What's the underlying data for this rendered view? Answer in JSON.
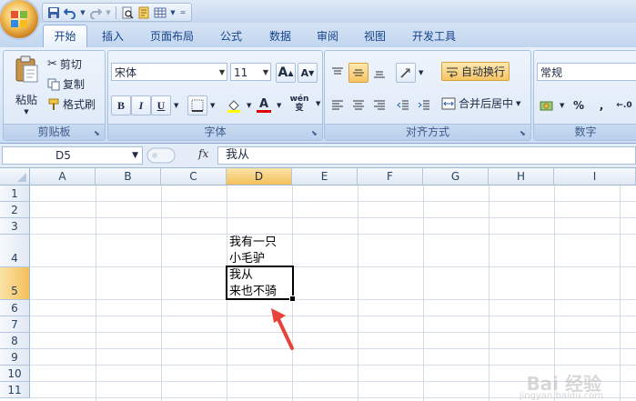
{
  "quick_access": {
    "save_icon": "save-icon",
    "undo_icon": "undo-icon",
    "redo_icon": "redo-icon"
  },
  "tabs": [
    "开始",
    "插入",
    "页面布局",
    "公式",
    "数据",
    "审阅",
    "视图",
    "开发工具"
  ],
  "clipboard": {
    "paste_label": "粘贴",
    "cut_label": "剪切",
    "copy_label": "复制",
    "format_painter_label": "格式刷",
    "group_label": "剪贴板"
  },
  "font": {
    "name": "宋体",
    "size": "11",
    "bold": "B",
    "italic": "I",
    "underline": "U",
    "font_color_glyph": "A",
    "phonetic_glyph": "wén 变",
    "grow_glyph": "A",
    "shrink_glyph": "A",
    "group_label": "字体"
  },
  "alignment": {
    "wrap_text_label": "自动换行",
    "merge_center_label": "合并后居中",
    "group_label": "对齐方式"
  },
  "number": {
    "format": "常规",
    "percent_glyph": "%",
    "comma_glyph": ",",
    "group_label": "数字"
  },
  "formula_bar": {
    "name_box": "D5",
    "fx": "fx",
    "content": "我从"
  },
  "grid": {
    "columns": [
      "A",
      "B",
      "C",
      "D",
      "E",
      "F",
      "G",
      "H",
      "I"
    ],
    "rows": [
      "1",
      "2",
      "3",
      "4",
      "5",
      "6",
      "7",
      "8",
      "9",
      "10",
      "11"
    ],
    "selected_column": "D",
    "selected_row": "5",
    "cells": {
      "D4_line1": "我有一只",
      "D4_line2": "小毛驴",
      "D5_line1": "我从",
      "D5_line2": "来也不骑"
    }
  },
  "watermark": {
    "main": "Bai 经验",
    "sub": "jingyan.baidu.com"
  },
  "colors": {
    "accent_arrow": "#e8433a",
    "selection_header": "#f5c05a",
    "ribbon_text": "#15428b"
  }
}
